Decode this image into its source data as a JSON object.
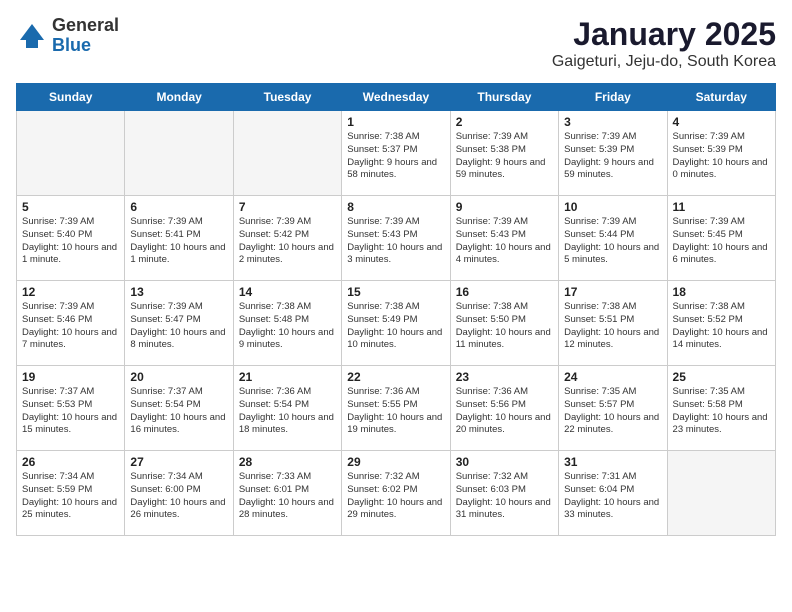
{
  "logo": {
    "general": "General",
    "blue": "Blue"
  },
  "title": "January 2025",
  "subtitle": "Gaigeturi, Jeju-do, South Korea",
  "headers": [
    "Sunday",
    "Monday",
    "Tuesday",
    "Wednesday",
    "Thursday",
    "Friday",
    "Saturday"
  ],
  "weeks": [
    [
      {
        "day": "",
        "text": ""
      },
      {
        "day": "",
        "text": ""
      },
      {
        "day": "",
        "text": ""
      },
      {
        "day": "1",
        "text": "Sunrise: 7:38 AM\nSunset: 5:37 PM\nDaylight: 9 hours\nand 58 minutes."
      },
      {
        "day": "2",
        "text": "Sunrise: 7:39 AM\nSunset: 5:38 PM\nDaylight: 9 hours\nand 59 minutes."
      },
      {
        "day": "3",
        "text": "Sunrise: 7:39 AM\nSunset: 5:39 PM\nDaylight: 9 hours\nand 59 minutes."
      },
      {
        "day": "4",
        "text": "Sunrise: 7:39 AM\nSunset: 5:39 PM\nDaylight: 10 hours\nand 0 minutes."
      }
    ],
    [
      {
        "day": "5",
        "text": "Sunrise: 7:39 AM\nSunset: 5:40 PM\nDaylight: 10 hours\nand 1 minute."
      },
      {
        "day": "6",
        "text": "Sunrise: 7:39 AM\nSunset: 5:41 PM\nDaylight: 10 hours\nand 1 minute."
      },
      {
        "day": "7",
        "text": "Sunrise: 7:39 AM\nSunset: 5:42 PM\nDaylight: 10 hours\nand 2 minutes."
      },
      {
        "day": "8",
        "text": "Sunrise: 7:39 AM\nSunset: 5:43 PM\nDaylight: 10 hours\nand 3 minutes."
      },
      {
        "day": "9",
        "text": "Sunrise: 7:39 AM\nSunset: 5:43 PM\nDaylight: 10 hours\nand 4 minutes."
      },
      {
        "day": "10",
        "text": "Sunrise: 7:39 AM\nSunset: 5:44 PM\nDaylight: 10 hours\nand 5 minutes."
      },
      {
        "day": "11",
        "text": "Sunrise: 7:39 AM\nSunset: 5:45 PM\nDaylight: 10 hours\nand 6 minutes."
      }
    ],
    [
      {
        "day": "12",
        "text": "Sunrise: 7:39 AM\nSunset: 5:46 PM\nDaylight: 10 hours\nand 7 minutes."
      },
      {
        "day": "13",
        "text": "Sunrise: 7:39 AM\nSunset: 5:47 PM\nDaylight: 10 hours\nand 8 minutes."
      },
      {
        "day": "14",
        "text": "Sunrise: 7:38 AM\nSunset: 5:48 PM\nDaylight: 10 hours\nand 9 minutes."
      },
      {
        "day": "15",
        "text": "Sunrise: 7:38 AM\nSunset: 5:49 PM\nDaylight: 10 hours\nand 10 minutes."
      },
      {
        "day": "16",
        "text": "Sunrise: 7:38 AM\nSunset: 5:50 PM\nDaylight: 10 hours\nand 11 minutes."
      },
      {
        "day": "17",
        "text": "Sunrise: 7:38 AM\nSunset: 5:51 PM\nDaylight: 10 hours\nand 12 minutes."
      },
      {
        "day": "18",
        "text": "Sunrise: 7:38 AM\nSunset: 5:52 PM\nDaylight: 10 hours\nand 14 minutes."
      }
    ],
    [
      {
        "day": "19",
        "text": "Sunrise: 7:37 AM\nSunset: 5:53 PM\nDaylight: 10 hours\nand 15 minutes."
      },
      {
        "day": "20",
        "text": "Sunrise: 7:37 AM\nSunset: 5:54 PM\nDaylight: 10 hours\nand 16 minutes."
      },
      {
        "day": "21",
        "text": "Sunrise: 7:36 AM\nSunset: 5:54 PM\nDaylight: 10 hours\nand 18 minutes."
      },
      {
        "day": "22",
        "text": "Sunrise: 7:36 AM\nSunset: 5:55 PM\nDaylight: 10 hours\nand 19 minutes."
      },
      {
        "day": "23",
        "text": "Sunrise: 7:36 AM\nSunset: 5:56 PM\nDaylight: 10 hours\nand 20 minutes."
      },
      {
        "day": "24",
        "text": "Sunrise: 7:35 AM\nSunset: 5:57 PM\nDaylight: 10 hours\nand 22 minutes."
      },
      {
        "day": "25",
        "text": "Sunrise: 7:35 AM\nSunset: 5:58 PM\nDaylight: 10 hours\nand 23 minutes."
      }
    ],
    [
      {
        "day": "26",
        "text": "Sunrise: 7:34 AM\nSunset: 5:59 PM\nDaylight: 10 hours\nand 25 minutes."
      },
      {
        "day": "27",
        "text": "Sunrise: 7:34 AM\nSunset: 6:00 PM\nDaylight: 10 hours\nand 26 minutes."
      },
      {
        "day": "28",
        "text": "Sunrise: 7:33 AM\nSunset: 6:01 PM\nDaylight: 10 hours\nand 28 minutes."
      },
      {
        "day": "29",
        "text": "Sunrise: 7:32 AM\nSunset: 6:02 PM\nDaylight: 10 hours\nand 29 minutes."
      },
      {
        "day": "30",
        "text": "Sunrise: 7:32 AM\nSunset: 6:03 PM\nDaylight: 10 hours\nand 31 minutes."
      },
      {
        "day": "31",
        "text": "Sunrise: 7:31 AM\nSunset: 6:04 PM\nDaylight: 10 hours\nand 33 minutes."
      },
      {
        "day": "",
        "text": ""
      }
    ]
  ]
}
